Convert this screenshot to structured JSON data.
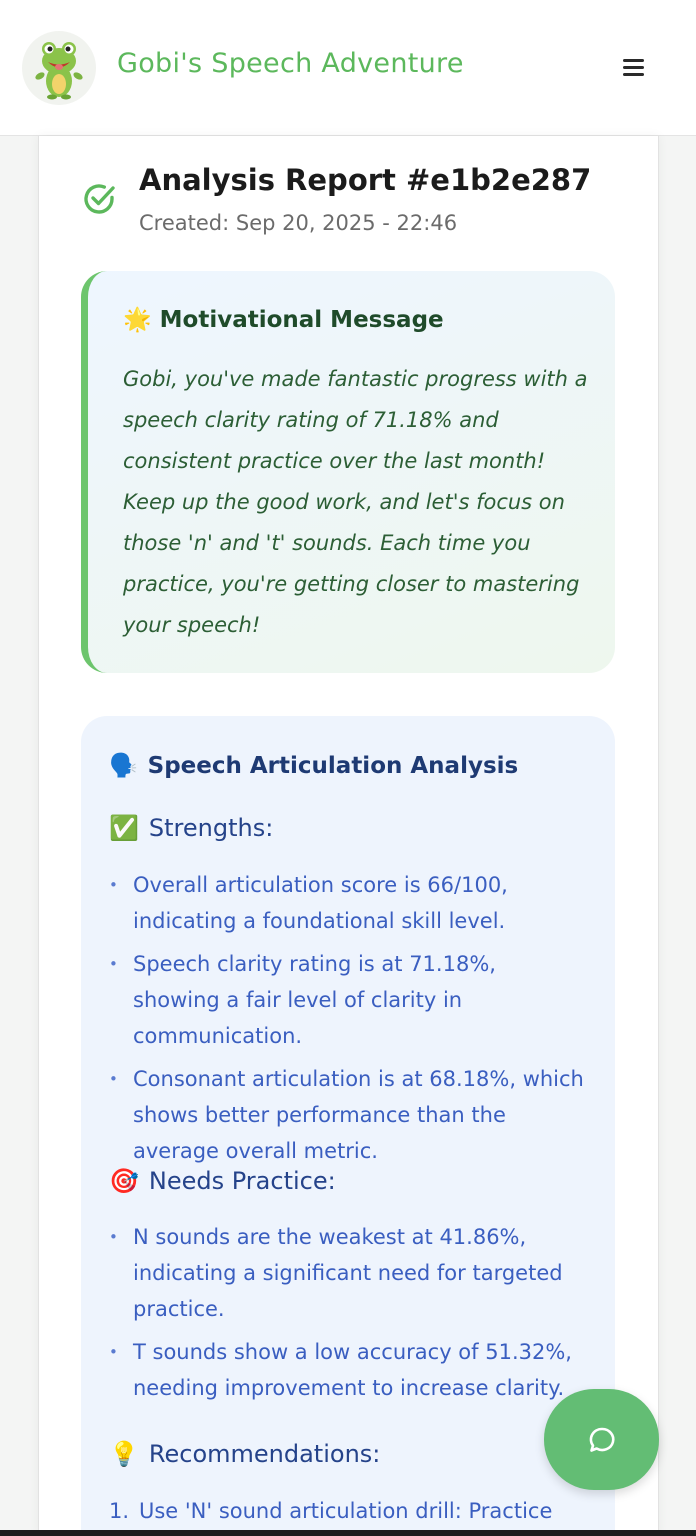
{
  "header": {
    "app_title": "Gobi's Speech Adventure",
    "logo_icon": "frog-mascot-icon",
    "menu_icon": "hamburger-menu-icon"
  },
  "report": {
    "title": "Analysis Report #e1b2e287",
    "created": "Created: Sep 20, 2025 - 22:46",
    "status_icon": "check-circle-icon"
  },
  "motivational": {
    "emoji": "🌟",
    "heading": "Motivational Message",
    "text": "Gobi, you've made fantastic progress with a speech clarity rating of 71.18% and consistent practice over the last month! Keep up the good work, and let's focus on those 'n' and 't' sounds. Each time you practice, you're getting closer to mastering your speech!"
  },
  "analysis": {
    "emoji": "🗣️",
    "heading": "Speech Articulation Analysis",
    "strengths": {
      "emoji": "✅",
      "title": "Strengths:",
      "items": [
        "Overall articulation score is 66/100, indicating a foundational skill level.",
        "Speech clarity rating is at 71.18%, showing a fair level of clarity in communication.",
        "Consonant articulation is at 68.18%, which shows better performance than the average overall metric."
      ]
    },
    "needs_practice": {
      "emoji": "🎯",
      "title": "Needs Practice:",
      "items": [
        "N sounds are the weakest at 41.86%, indicating a significant need for targeted practice.",
        "T sounds show a low accuracy of 51.32%, needing improvement to increase clarity."
      ]
    },
    "recommendations": {
      "emoji": "💡",
      "title": "Recommendations:",
      "items": [
        {
          "num": "1.",
          "text": "Use 'N' sound articulation drill: Practice"
        }
      ]
    }
  },
  "chat_fab_icon": "chat-bubble-icon",
  "colors": {
    "brand_green": "#5cb85c",
    "accent_green": "#6dc56d",
    "fab_green": "#63bd74",
    "analysis_blue": "#3a5ec0",
    "heading_navy": "#1e3a73"
  }
}
